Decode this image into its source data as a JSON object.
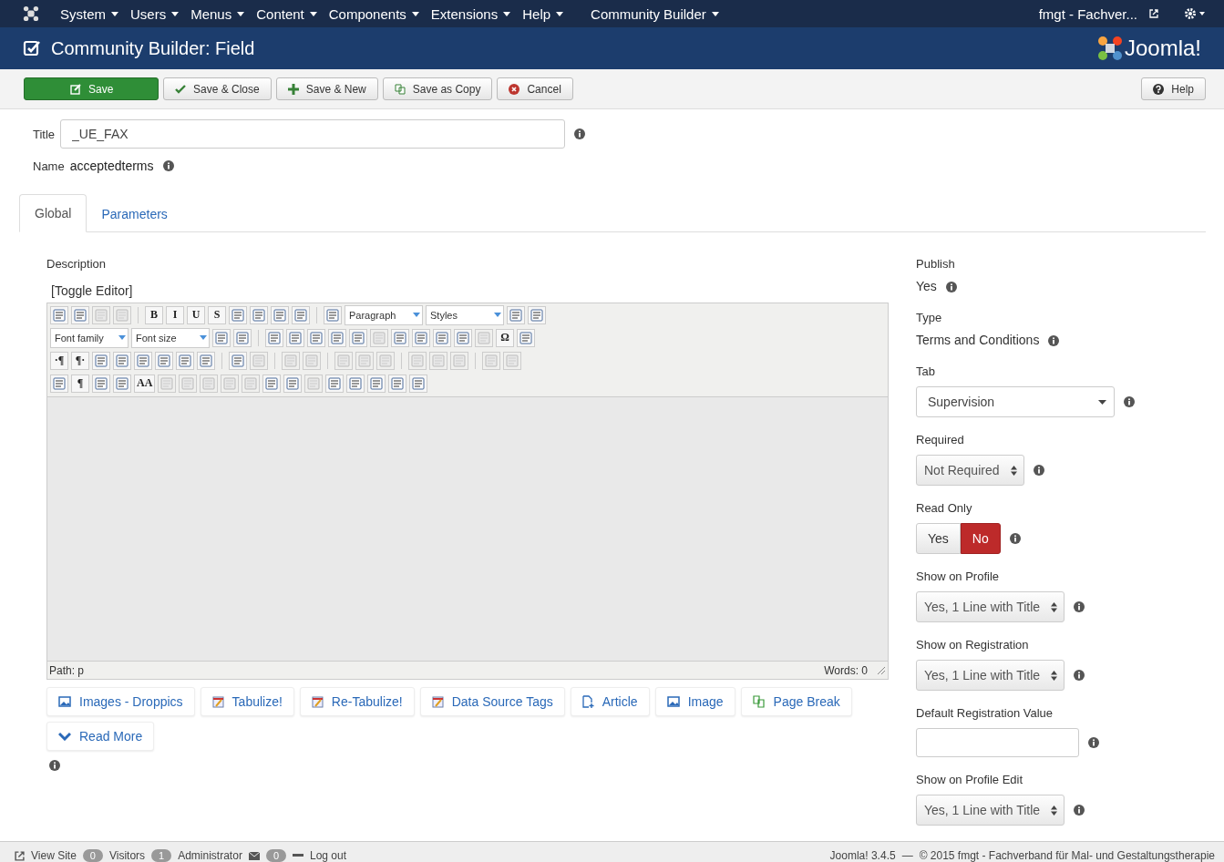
{
  "navbar": {
    "menus": [
      "System",
      "Users",
      "Menus",
      "Content",
      "Components",
      "Extensions",
      "Help",
      "Community Builder"
    ],
    "user": "fmgt - Fachver..."
  },
  "header": {
    "title": "Community Builder: Field",
    "logo": "Joomla!"
  },
  "toolbar": {
    "buttons": [
      {
        "kind": "save",
        "label": "Save"
      },
      {
        "kind": "check",
        "label": "Save & Close"
      },
      {
        "kind": "plus",
        "label": "Save & New"
      },
      {
        "kind": "copy",
        "label": "Save as Copy"
      },
      {
        "kind": "cancel",
        "label": "Cancel"
      }
    ],
    "help": "Help"
  },
  "title_field": {
    "label": "Title",
    "value": "_UE_FAX"
  },
  "name_field": {
    "label": "Name",
    "value": "acceptedterms"
  },
  "tabs": [
    {
      "label": "Global",
      "selected": true
    },
    {
      "label": "Parameters",
      "selected": false
    }
  ],
  "description": {
    "label": "Description",
    "toggle": "[Toggle Editor]",
    "editor_toolbar": [
      [
        {
          "kind": "icon",
          "disabled": false
        },
        {
          "kind": "icon",
          "disabled": false
        },
        {
          "kind": "icon",
          "disabled": true
        },
        {
          "kind": "icon",
          "disabled": true
        },
        {
          "kind": "sep"
        },
        {
          "kind": "text",
          "label": "B",
          "disabled": false
        },
        {
          "kind": "text",
          "label": "I",
          "disabled": false
        },
        {
          "kind": "text",
          "label": "U",
          "disabled": false
        },
        {
          "kind": "text",
          "label": "S",
          "disabled": false
        },
        {
          "kind": "icon",
          "disabled": false
        },
        {
          "kind": "icon",
          "disabled": false
        },
        {
          "kind": "icon",
          "disabled": false
        },
        {
          "kind": "icon",
          "disabled": false
        },
        {
          "kind": "sep"
        },
        {
          "kind": "icon",
          "disabled": false
        },
        {
          "kind": "select",
          "label": "Paragraph"
        },
        {
          "kind": "select",
          "label": "Styles"
        },
        {
          "kind": "icon",
          "disabled": false
        },
        {
          "kind": "icon",
          "disabled": false
        }
      ],
      [
        {
          "kind": "select",
          "label": "Font family"
        },
        {
          "kind": "select",
          "label": "Font size"
        },
        {
          "kind": "icon",
          "disabled": false
        },
        {
          "kind": "icon",
          "disabled": false
        },
        {
          "kind": "sep"
        },
        {
          "kind": "icon",
          "disabled": false
        },
        {
          "kind": "icon",
          "disabled": false
        },
        {
          "kind": "icon",
          "disabled": false
        },
        {
          "kind": "icon",
          "disabled": false
        },
        {
          "kind": "icon",
          "disabled": false
        },
        {
          "kind": "icon",
          "disabled": true
        },
        {
          "kind": "icon",
          "disabled": false
        },
        {
          "kind": "icon",
          "disabled": false
        },
        {
          "kind": "icon",
          "disabled": false
        },
        {
          "kind": "icon",
          "disabled": false
        },
        {
          "kind": "icon",
          "disabled": true
        },
        {
          "kind": "text",
          "label": "Ω",
          "disabled": false
        },
        {
          "kind": "icon",
          "disabled": false
        }
      ],
      [
        {
          "kind": "text",
          "label": "·¶",
          "disabled": false
        },
        {
          "kind": "text",
          "label": "¶·",
          "disabled": false
        },
        {
          "kind": "icon",
          "disabled": false
        },
        {
          "kind": "icon",
          "disabled": false
        },
        {
          "kind": "icon",
          "disabled": false
        },
        {
          "kind": "icon",
          "disabled": false
        },
        {
          "kind": "icon",
          "disabled": false
        },
        {
          "kind": "icon",
          "disabled": false
        },
        {
          "kind": "sep"
        },
        {
          "kind": "icon",
          "disabled": false
        },
        {
          "kind": "icon",
          "disabled": true
        },
        {
          "kind": "sep"
        },
        {
          "kind": "icon",
          "disabled": true
        },
        {
          "kind": "icon",
          "disabled": true
        },
        {
          "kind": "sep"
        },
        {
          "kind": "icon",
          "disabled": true
        },
        {
          "kind": "icon",
          "disabled": true
        },
        {
          "kind": "icon",
          "disabled": true
        },
        {
          "kind": "sep"
        },
        {
          "kind": "icon",
          "disabled": true
        },
        {
          "kind": "icon",
          "disabled": true
        },
        {
          "kind": "icon",
          "disabled": true
        },
        {
          "kind": "sep"
        },
        {
          "kind": "icon",
          "disabled": true
        },
        {
          "kind": "icon",
          "disabled": true
        }
      ],
      [
        {
          "kind": "icon",
          "disabled": false
        },
        {
          "kind": "text",
          "label": "¶",
          "disabled": false
        },
        {
          "kind": "icon",
          "disabled": false
        },
        {
          "kind": "icon",
          "disabled": false
        },
        {
          "kind": "text",
          "label": "AA",
          "disabled": false
        },
        {
          "kind": "icon",
          "disabled": true
        },
        {
          "kind": "icon",
          "disabled": true
        },
        {
          "kind": "icon",
          "disabled": true
        },
        {
          "kind": "icon",
          "disabled": true
        },
        {
          "kind": "icon",
          "disabled": true
        },
        {
          "kind": "icon",
          "disabled": false
        },
        {
          "kind": "icon",
          "disabled": false
        },
        {
          "kind": "icon",
          "disabled": true
        },
        {
          "kind": "icon",
          "disabled": false
        },
        {
          "kind": "icon",
          "disabled": false
        },
        {
          "kind": "icon",
          "disabled": false
        },
        {
          "kind": "icon",
          "disabled": false
        },
        {
          "kind": "icon",
          "disabled": false
        }
      ]
    ],
    "path": "Path:  p",
    "words": "Words: 0",
    "buttons": [
      {
        "kind": "image",
        "label": "Images - Droppics"
      },
      {
        "kind": "table",
        "label": "Tabulize!"
      },
      {
        "kind": "table",
        "label": "Re-Tabulize!"
      },
      {
        "kind": "table",
        "label": "Data Source Tags"
      },
      {
        "kind": "article",
        "label": "Article"
      },
      {
        "kind": "image",
        "label": "Image"
      },
      {
        "kind": "pagebreak",
        "label": "Page Break"
      },
      {
        "kind": "readmore",
        "label": "Read More"
      }
    ]
  },
  "settings": [
    {
      "kind": "text",
      "label": "Publish",
      "value": "Yes"
    },
    {
      "kind": "text",
      "label": "Type",
      "value": "Terms and Conditions"
    },
    {
      "kind": "dropdown",
      "label": "Tab",
      "value": "Supervision"
    },
    {
      "kind": "select",
      "label": "Required",
      "value": "Not Required"
    },
    {
      "kind": "toggle",
      "label": "Read Only",
      "options": [
        {
          "label": "Yes",
          "selected": false
        },
        {
          "label": "No",
          "selected": true
        }
      ]
    },
    {
      "kind": "select",
      "label": "Show on Profile",
      "value": "Yes, 1 Line with Title"
    },
    {
      "kind": "select",
      "label": "Show on Registration",
      "value": "Yes, 1 Line with Title"
    },
    {
      "kind": "input",
      "label": "Default Registration Value"
    },
    {
      "kind": "select",
      "label": "Show on Profile Edit",
      "value": "Yes, 1 Line with Title"
    }
  ],
  "status_bar": {
    "view_site": "View Site",
    "visitors_count": "0",
    "visitors": "Visitors",
    "admins_count": "1",
    "admins": "Administrator",
    "messages_count": "0",
    "logout": "Log out",
    "version": "Joomla! 3.4.5",
    "separator": "—",
    "copyright": "© 2015 fmgt - Fachverband für Mal- und Gestaltungstherapie"
  }
}
